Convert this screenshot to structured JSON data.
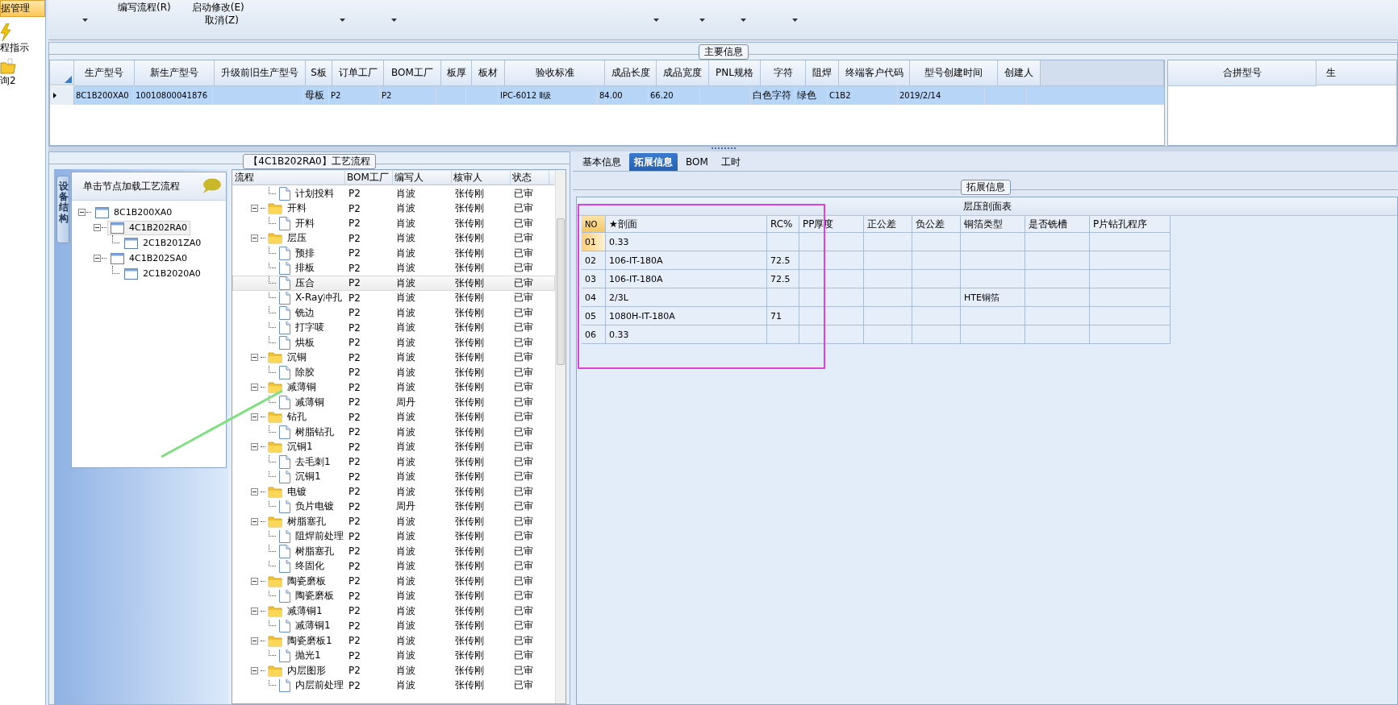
{
  "sidebar": {
    "items": [
      {
        "label": "据管理",
        "selected": true
      },
      {
        "label": "程指示",
        "selected": false
      },
      {
        "label": "询2",
        "selected": false
      }
    ]
  },
  "toolbar": {
    "buttons": [
      {
        "label": "编写流程(R)"
      },
      {
        "label": "启动修改(E)"
      },
      {
        "label": "取消(Z)"
      }
    ]
  },
  "main_info": {
    "legend": "主要信息",
    "columns": [
      "生产型号",
      "新生产型号",
      "升级前旧生产型号",
      "S板",
      "订单工厂",
      "BOM工厂",
      "板厚",
      "板材",
      "验收标准",
      "成品长度",
      "成品宽度",
      "PNL规格",
      "字符",
      "阻焊",
      "终端客户代码",
      "型号创建时间",
      "创建人"
    ],
    "rows": [
      {
        "selected": true,
        "cells": [
          "8C1B200XA0",
          "10010800041876",
          null,
          "母板",
          "P2",
          "P2",
          null,
          null,
          "IPC-6012 Ⅱ级",
          "84.00",
          "66.20",
          null,
          "白色字符",
          "绿色",
          "C1B2",
          "2019/2/14",
          null
        ]
      }
    ],
    "side_columns": [
      "合拼型号",
      "生"
    ]
  },
  "process": {
    "legend": "【4C1B202RA0】工艺流程",
    "side_tab": "设备结构",
    "tree_header": "单击节点加载工艺流程",
    "tree": [
      {
        "label": "8C1B200XA0",
        "selected": false,
        "expanded": true,
        "children": [
          {
            "label": "4C1B202RA0",
            "selected": true,
            "expanded": true,
            "children": [
              {
                "label": "2C1B201ZA0",
                "selected": false
              }
            ]
          },
          {
            "label": "4C1B202SA0",
            "selected": false,
            "expanded": true,
            "children": [
              {
                "label": "2C1B2020A0",
                "selected": false
              }
            ]
          }
        ]
      }
    ],
    "columns": [
      "流程",
      "BOM工厂",
      "编写人",
      "核审人",
      "状态"
    ],
    "rows": [
      {
        "kind": "leaf",
        "name": "计划投料",
        "bom": "P2",
        "writer": "肖波",
        "reviewer": "张传刚",
        "status": "已审",
        "selected": false
      },
      {
        "kind": "folder",
        "name": "开料",
        "bom": "P2",
        "writer": "肖波",
        "reviewer": "张传刚",
        "status": "已审",
        "selected": false,
        "expanded": true,
        "children": [
          {
            "kind": "leaf",
            "name": "开料",
            "bom": "P2",
            "writer": "肖波",
            "reviewer": "张传刚",
            "status": "已审",
            "selected": false
          }
        ]
      },
      {
        "kind": "folder",
        "name": "层压",
        "bom": "P2",
        "writer": "肖波",
        "reviewer": "张传刚",
        "status": "已审",
        "selected": false,
        "expanded": true,
        "children": [
          {
            "kind": "leaf",
            "name": "预排",
            "bom": "P2",
            "writer": "肖波",
            "reviewer": "张传刚",
            "status": "已审",
            "selected": false
          },
          {
            "kind": "leaf",
            "name": "排板",
            "bom": "P2",
            "writer": "肖波",
            "reviewer": "张传刚",
            "status": "已审",
            "selected": false
          },
          {
            "kind": "leaf",
            "name": "压合",
            "bom": "P2",
            "writer": "肖波",
            "reviewer": "张传刚",
            "status": "已审",
            "selected": true
          },
          {
            "kind": "leaf",
            "name": "X-Ray冲孔",
            "bom": "P2",
            "writer": "肖波",
            "reviewer": "张传刚",
            "status": "已审",
            "selected": false
          },
          {
            "kind": "leaf",
            "name": "铣边",
            "bom": "P2",
            "writer": "肖波",
            "reviewer": "张传刚",
            "status": "已审",
            "selected": false
          },
          {
            "kind": "leaf",
            "name": "打字唛",
            "bom": "P2",
            "writer": "肖波",
            "reviewer": "张传刚",
            "status": "已审",
            "selected": false
          },
          {
            "kind": "leaf",
            "name": "烘板",
            "bom": "P2",
            "writer": "肖波",
            "reviewer": "张传刚",
            "status": "已审",
            "selected": false
          }
        ]
      },
      {
        "kind": "folder",
        "name": "沉铜",
        "bom": "P2",
        "writer": "肖波",
        "reviewer": "张传刚",
        "status": "已审",
        "selected": false,
        "expanded": true,
        "children": [
          {
            "kind": "leaf",
            "name": "除胶",
            "bom": "P2",
            "writer": "肖波",
            "reviewer": "张传刚",
            "status": "已审",
            "selected": false
          }
        ]
      },
      {
        "kind": "folder",
        "name": "减薄铜",
        "bom": "P2",
        "writer": "肖波",
        "reviewer": "张传刚",
        "status": "已审",
        "selected": false,
        "expanded": true,
        "children": [
          {
            "kind": "leaf",
            "name": "减薄铜",
            "bom": "P2",
            "writer": "周丹",
            "reviewer": "张传刚",
            "status": "已审",
            "selected": false
          }
        ]
      },
      {
        "kind": "folder",
        "name": "钻孔",
        "bom": "P2",
        "writer": "肖波",
        "reviewer": "张传刚",
        "status": "已审",
        "selected": false,
        "expanded": true,
        "children": [
          {
            "kind": "leaf",
            "name": "树脂钻孔",
            "bom": "P2",
            "writer": "肖波",
            "reviewer": "张传刚",
            "status": "已审",
            "selected": false
          }
        ]
      },
      {
        "kind": "folder",
        "name": "沉铜1",
        "bom": "P2",
        "writer": "肖波",
        "reviewer": "张传刚",
        "status": "已审",
        "selected": false,
        "expanded": true,
        "children": [
          {
            "kind": "leaf",
            "name": "去毛刺1",
            "bom": "P2",
            "writer": "肖波",
            "reviewer": "张传刚",
            "status": "已审",
            "selected": false
          },
          {
            "kind": "leaf",
            "name": "沉铜1",
            "bom": "P2",
            "writer": "肖波",
            "reviewer": "张传刚",
            "status": "已审",
            "selected": false
          }
        ]
      },
      {
        "kind": "folder",
        "name": "电镀",
        "bom": "P2",
        "writer": "肖波",
        "reviewer": "张传刚",
        "status": "已审",
        "selected": false,
        "expanded": true,
        "children": [
          {
            "kind": "leaf",
            "name": "负片电镀",
            "bom": "P2",
            "writer": "周丹",
            "reviewer": "张传刚",
            "status": "已审",
            "selected": false
          }
        ]
      },
      {
        "kind": "folder",
        "name": "树脂塞孔",
        "bom": "P2",
        "writer": "肖波",
        "reviewer": "张传刚",
        "status": "已审",
        "selected": false,
        "expanded": true,
        "children": [
          {
            "kind": "leaf",
            "name": "阻焊前处理",
            "bom": "P2",
            "writer": "肖波",
            "reviewer": "张传刚",
            "status": "已审",
            "selected": false
          },
          {
            "kind": "leaf",
            "name": "树脂塞孔",
            "bom": "P2",
            "writer": "肖波",
            "reviewer": "张传刚",
            "status": "已审",
            "selected": false
          },
          {
            "kind": "leaf",
            "name": "终固化",
            "bom": "P2",
            "writer": "肖波",
            "reviewer": "张传刚",
            "status": "已审",
            "selected": false
          }
        ]
      },
      {
        "kind": "folder",
        "name": "陶瓷磨板",
        "bom": "P2",
        "writer": "肖波",
        "reviewer": "张传刚",
        "status": "已审",
        "selected": false,
        "expanded": true,
        "children": [
          {
            "kind": "leaf",
            "name": "陶瓷磨板",
            "bom": "P2",
            "writer": "肖波",
            "reviewer": "张传刚",
            "status": "已审",
            "selected": false
          }
        ]
      },
      {
        "kind": "folder",
        "name": "减薄铜1",
        "bom": "P2",
        "writer": "肖波",
        "reviewer": "张传刚",
        "status": "已审",
        "selected": false,
        "expanded": true,
        "children": [
          {
            "kind": "leaf",
            "name": "减薄铜1",
            "bom": "P2",
            "writer": "肖波",
            "reviewer": "张传刚",
            "status": "已审",
            "selected": false
          }
        ]
      },
      {
        "kind": "folder",
        "name": "陶瓷磨板1",
        "bom": "P2",
        "writer": "肖波",
        "reviewer": "张传刚",
        "status": "已审",
        "selected": false,
        "expanded": true,
        "children": [
          {
            "kind": "leaf",
            "name": "抛光1",
            "bom": "P2",
            "writer": "肖波",
            "reviewer": "张传刚",
            "status": "已审",
            "selected": false
          }
        ]
      },
      {
        "kind": "folder",
        "name": "内层图形",
        "bom": "P2",
        "writer": "肖波",
        "reviewer": "张传刚",
        "status": "已审",
        "selected": false,
        "expanded": true,
        "children": [
          {
            "kind": "leaf",
            "name": "内层前处理",
            "bom": "P2",
            "writer": "肖波",
            "reviewer": "张传刚",
            "status": "已审",
            "selected": false
          }
        ]
      }
    ]
  },
  "detail": {
    "tabs": [
      {
        "label": "基本信息",
        "selected": false
      },
      {
        "label": "拓展信息",
        "selected": true
      },
      {
        "label": "BOM",
        "selected": false
      },
      {
        "label": "工时",
        "selected": false
      }
    ],
    "legend": "拓展信息",
    "table_title": "层压剖面表",
    "columns": [
      "NO",
      "★剖面",
      "RC%",
      "PP厚度",
      "正公差",
      "负公差",
      "铜箔类型",
      "是否铣槽",
      "P片钻孔程序"
    ],
    "rows": [
      {
        "selected": true,
        "cells": [
          "01",
          "0.33",
          null,
          null,
          null,
          null,
          null,
          null,
          null
        ]
      },
      {
        "selected": false,
        "cells": [
          "02",
          "106-IT-180A",
          "72.5",
          null,
          null,
          null,
          null,
          null,
          null
        ]
      },
      {
        "selected": false,
        "cells": [
          "03",
          "106-IT-180A",
          "72.5",
          null,
          null,
          null,
          null,
          null,
          null
        ]
      },
      {
        "selected": false,
        "cells": [
          "04",
          "2/3L",
          null,
          null,
          null,
          null,
          "HTE铜箔",
          null,
          null
        ]
      },
      {
        "selected": false,
        "cells": [
          "05",
          "1080H-IT-180A",
          "71",
          null,
          null,
          null,
          null,
          null,
          null
        ]
      },
      {
        "selected": false,
        "cells": [
          "06",
          "0.33",
          null,
          null,
          null,
          null,
          null,
          null,
          null
        ]
      }
    ]
  }
}
